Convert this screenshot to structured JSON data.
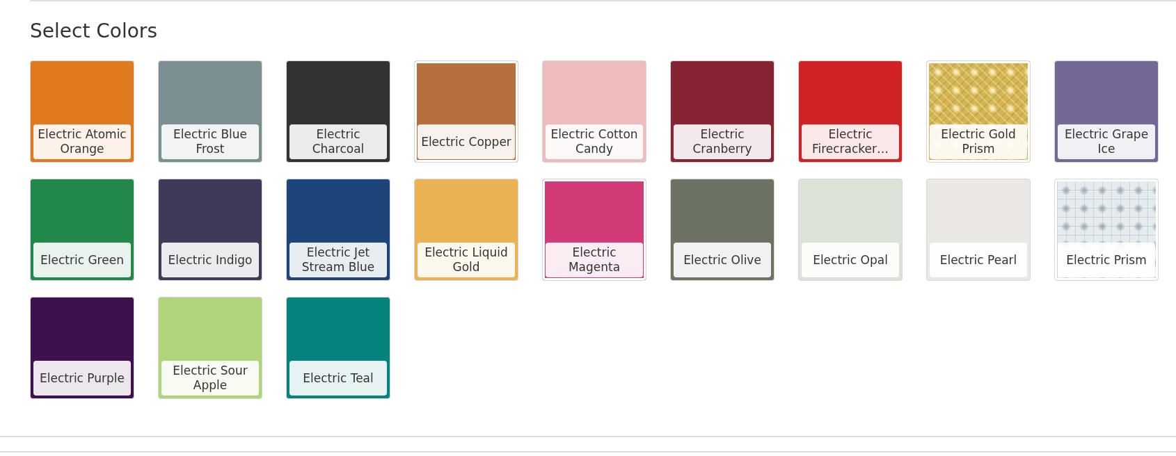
{
  "title": "Select Colors",
  "colors": [
    {
      "name": "Electric Atomic Orange",
      "color": "#e07a1f",
      "kind": "solid"
    },
    {
      "name": "Electric Blue Frost",
      "color": "#7b8f92",
      "kind": "solid"
    },
    {
      "name": "Electric Charcoal",
      "color": "#343332",
      "kind": "solid"
    },
    {
      "name": "Electric Copper",
      "color": "#b86f40",
      "kind": "framed"
    },
    {
      "name": "Electric Cotton Candy",
      "color": "#eebcbc",
      "kind": "solid"
    },
    {
      "name": "Electric Cranberry",
      "color": "#862433",
      "kind": "solid"
    },
    {
      "name": "Electric Firecracker…",
      "color": "#d12326",
      "kind": "solid"
    },
    {
      "name": "Electric Gold Prism",
      "color": "#d4b553",
      "kind": "textured"
    },
    {
      "name": "Electric Grape Ice",
      "color": "#746896",
      "kind": "solid"
    },
    {
      "name": "Electric Green",
      "color": "#218849",
      "kind": "solid"
    },
    {
      "name": "Electric Indigo",
      "color": "#3d3b58",
      "kind": "solid"
    },
    {
      "name": "Electric Jet Stream Blue",
      "color": "#1d4579",
      "kind": "solid"
    },
    {
      "name": "Electric Liquid Gold",
      "color": "#eab252",
      "kind": "solid"
    },
    {
      "name": "Electric Magenta",
      "color": "#d33a78",
      "kind": "framed"
    },
    {
      "name": "Electric Olive",
      "color": "#6c7363",
      "kind": "solid"
    },
    {
      "name": "Electric Opal",
      "color": "#dbe3d8",
      "kind": "solid"
    },
    {
      "name": "Electric Pearl",
      "color": "#ebe8e4",
      "kind": "solid"
    },
    {
      "name": "Electric Prism",
      "color": "#e6ecee",
      "kind": "textured"
    },
    {
      "name": "Electric Purple",
      "color": "#3d114e",
      "kind": "solid"
    },
    {
      "name": "Electric Sour Apple",
      "color": "#b0d47a",
      "kind": "solid"
    },
    {
      "name": "Electric Teal",
      "color": "#06827f",
      "kind": "solid"
    }
  ]
}
